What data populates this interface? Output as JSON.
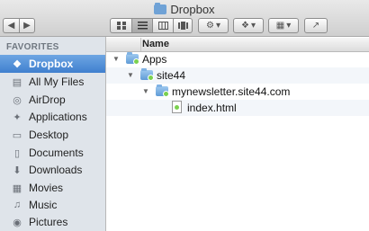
{
  "window": {
    "title": "Dropbox"
  },
  "toolbar": {
    "back_glyph": "◀",
    "forward_glyph": "▶",
    "view_icons": "icon-view-icon",
    "view_list": "list-view-icon",
    "view_columns": "column-view-icon",
    "view_coverflow": "coverflow-view-icon",
    "action_glyph": "⚙",
    "dropbox_glyph": "❖",
    "arrange_glyph": "▦",
    "share_glyph": "↗",
    "dropdown_glyph": "▾"
  },
  "sidebar": {
    "header": "FAVORITES",
    "items": [
      {
        "label": "Dropbox",
        "icon": "dropbox-icon",
        "glyph": "❖",
        "selected": true
      },
      {
        "label": "All My Files",
        "icon": "all-files-icon",
        "glyph": "▤"
      },
      {
        "label": "AirDrop",
        "icon": "airdrop-icon",
        "glyph": "◎"
      },
      {
        "label": "Applications",
        "icon": "applications-icon",
        "glyph": "✦"
      },
      {
        "label": "Desktop",
        "icon": "desktop-icon",
        "glyph": "▭"
      },
      {
        "label": "Documents",
        "icon": "documents-icon",
        "glyph": "▯"
      },
      {
        "label": "Downloads",
        "icon": "downloads-icon",
        "glyph": "⬇"
      },
      {
        "label": "Movies",
        "icon": "movies-icon",
        "glyph": "▦"
      },
      {
        "label": "Music",
        "icon": "music-icon",
        "glyph": "♫"
      },
      {
        "label": "Pictures",
        "icon": "pictures-icon",
        "glyph": "◉"
      }
    ]
  },
  "list": {
    "column_name": "Name",
    "rows": [
      {
        "label": "Apps",
        "type": "folder",
        "expanded": true
      },
      {
        "label": "site44",
        "type": "folder",
        "expanded": true
      },
      {
        "label": "mynewsletter.site44.com",
        "type": "folder",
        "expanded": true
      },
      {
        "label": "index.html",
        "type": "file"
      }
    ],
    "expand_glyph": "▼"
  },
  "colors": {
    "sidebar_bg": "#dfe4ea",
    "selection": "#3f7fcf",
    "folder": "#5f9bd6",
    "sync_badge": "#7bd14f"
  }
}
